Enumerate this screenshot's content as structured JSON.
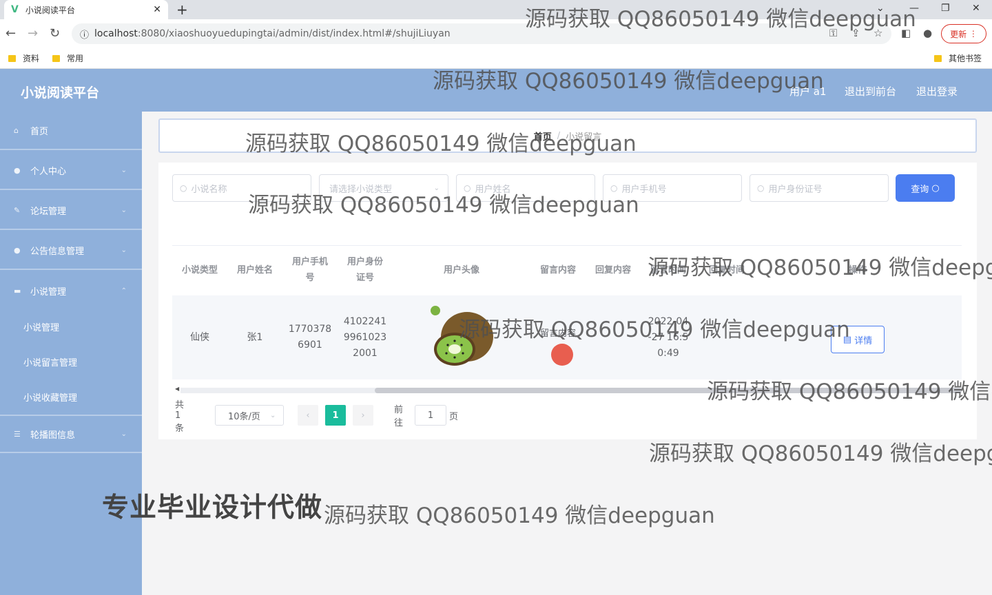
{
  "browser": {
    "tab_title": "小说阅读平台",
    "url_host": "localhost",
    "url_rest": ":8080/xiaoshuoyuedupingtai/admin/dist/index.html#/shujiLiuyan",
    "update_label": "更新",
    "bookmarks": [
      "资料",
      "常用"
    ],
    "other_bookmarks": "其他书签"
  },
  "header": {
    "brand": "小说阅读平台",
    "user": "用户 a1",
    "back_to_front": "退出到前台",
    "logout": "退出登录"
  },
  "sidebar": {
    "items": [
      {
        "label": "首页",
        "icon": "home-icon"
      },
      {
        "label": "个人中心",
        "icon": "user-icon"
      },
      {
        "label": "论坛管理",
        "icon": "forum-icon"
      },
      {
        "label": "公告信息管理",
        "icon": "notice-icon"
      },
      {
        "label": "小说管理",
        "icon": "book-icon"
      }
    ],
    "subitems": [
      "小说管理",
      "小说留言管理",
      "小说收藏管理"
    ],
    "last_item": {
      "label": "轮播图信息",
      "icon": "menu-icon"
    }
  },
  "breadcrumb": {
    "home": "首页",
    "current": "小说留言"
  },
  "filters": {
    "novel_name": "小说名称",
    "novel_type": "请选择小说类型",
    "user_name": "用户姓名",
    "user_phone": "用户手机号",
    "user_id_card": "用户身份证号",
    "query_label": "查询"
  },
  "table": {
    "headers": {
      "novel_type": "小说类型",
      "user_name": "用户姓名",
      "phone_l1": "用户手机",
      "phone_l2": "号",
      "id_l1": "用户身份",
      "id_l2": "证号",
      "avatar": "用户头像",
      "msg_content": "留言内容",
      "reply_content": "回复内容",
      "msg_time": "留言时间",
      "reply_time": "回复时间",
      "action": "操作"
    },
    "rows": [
      {
        "novel_type": "仙侠",
        "user_name": "张1",
        "phone_l1": "1770378",
        "phone_l2": "6901",
        "id_l1": "4102241",
        "id_l2": "9961023",
        "id_l3": "2001",
        "msg_content": "留言内容",
        "time_l1": "2022-04",
        "time_l2": "-27 16:5",
        "time_l3": "0:49",
        "detail_label": "详情"
      }
    ]
  },
  "pagination": {
    "total": "共 1 条",
    "page_size": "10条/页",
    "current_page": "1",
    "goto_prefix": "前往",
    "goto_value": "1",
    "goto_suffix": "页"
  },
  "watermarks": {
    "text": "源码获取 QQ86050149 微信deepguan",
    "big": "专业毕业设计代做"
  }
}
